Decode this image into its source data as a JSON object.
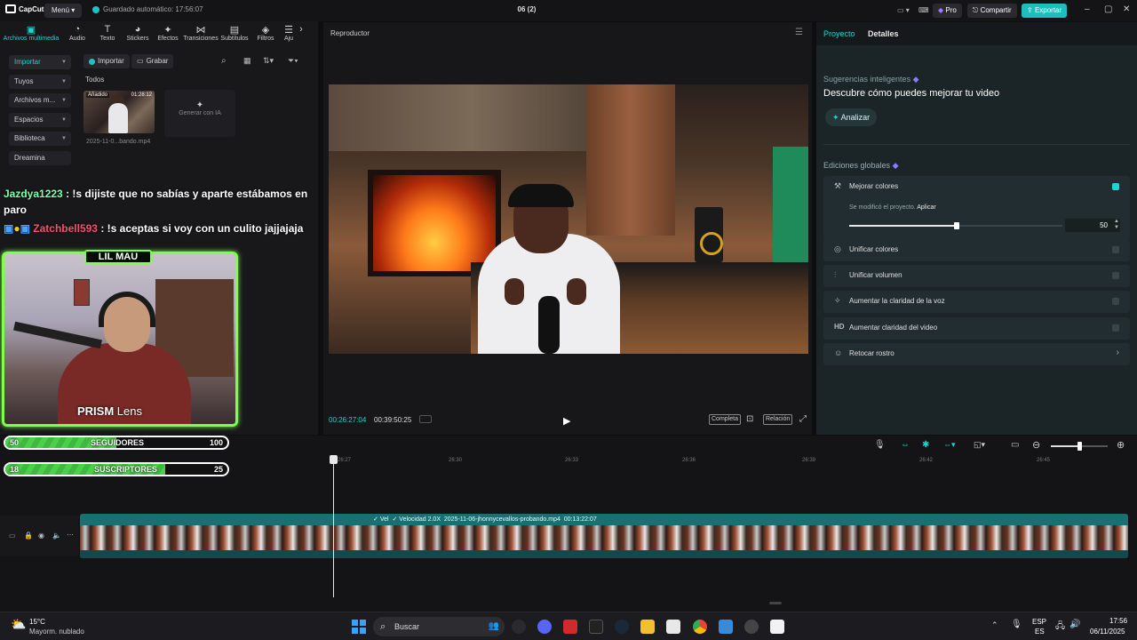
{
  "titlebar": {
    "app": "CapCut",
    "menu": "Menú",
    "autosave": "Guardado automático: 17:56:07",
    "project_title": "06 (2)",
    "pro": "Pro",
    "share": "Compartir",
    "export": "Exportar"
  },
  "tools": [
    {
      "label": "Archivos multimedia",
      "icon": "media-icon"
    },
    {
      "label": "Audio",
      "icon": "audio-icon"
    },
    {
      "label": "Texto",
      "icon": "text-icon"
    },
    {
      "label": "Stickers",
      "icon": "sticker-icon"
    },
    {
      "label": "Efectos",
      "icon": "effects-icon"
    },
    {
      "label": "Transiciones",
      "icon": "transitions-icon"
    },
    {
      "label": "Subtítulos",
      "icon": "subtitles-icon"
    },
    {
      "label": "Filtros",
      "icon": "filters-icon"
    },
    {
      "label": "Aju",
      "icon": "adjust-icon"
    }
  ],
  "sidebar": {
    "items": [
      "Importar",
      "Tuyos",
      "Archivos m...",
      "Espacios",
      "Biblioteca",
      "Dreamina"
    ]
  },
  "media": {
    "import": "Importar",
    "record": "Grabar",
    "all": "Todos",
    "added": "Añadido",
    "duration": "01:28:12",
    "filename": "2025-11-0...bando.mp4",
    "generate_ai": "Generar con IA"
  },
  "chat": [
    {
      "user": "Jazdya1223",
      "message": " : !s dijiste que no sabías y aparte estábamos en paro"
    },
    {
      "user": "Zatchbell593",
      "message": " : !s aceptas si voy con un culito jajjajaja"
    }
  ],
  "overlay": {
    "name": "LIL MAU",
    "prism": "PRISM",
    "prism_suffix": " Lens",
    "followers": {
      "current": "50",
      "label": "SEGUIDORES",
      "goal": "100",
      "progress": 0.5
    },
    "subscribers": {
      "current": "18",
      "label": "SUSCRIPTORES",
      "goal": "25",
      "progress": 0.72
    }
  },
  "player": {
    "header": "Reproductor",
    "current_time": "00:26:27:04",
    "total_time": "00:39:50:25",
    "full": "Completa",
    "ratio": "Relación"
  },
  "rightpanel": {
    "tab_project": "Proyecto",
    "tab_details": "Detalles",
    "smart_title": "Sugerencias inteligentes",
    "smart_desc": "Descubre cómo puedes mejorar tu video",
    "analyze": "Analizar",
    "global_title": "Ediciones globales",
    "enhance_colors": "Mejorar colores",
    "modified_note": "Se modificó el proyecto.",
    "apply": "Aplicar",
    "slider_value": "50",
    "items": [
      "Unificar colores",
      "Unificar volumen",
      "Aumentar la claridad de la voz",
      "Aumentar claridad del video",
      "Retocar rostro"
    ],
    "accent": "#22d3d3"
  },
  "timeline": {
    "ruler": [
      "26:27",
      "26:30",
      "26:33",
      "26:36",
      "26:39",
      "26:42",
      "26:45"
    ],
    "clip_label_vel": "Vel",
    "clip_speed": "Velocidad 2.0X",
    "clip_name": "2025-11-06-jhonnycevallos-probando.mp4",
    "clip_duration": "00:13:22:07"
  },
  "taskbar": {
    "temp": "15°C",
    "weather": "Mayorm. nublado",
    "search": "Buscar",
    "lang1": "ESP",
    "lang2": "ES",
    "time": "17:56",
    "date": "06/11/2025"
  }
}
